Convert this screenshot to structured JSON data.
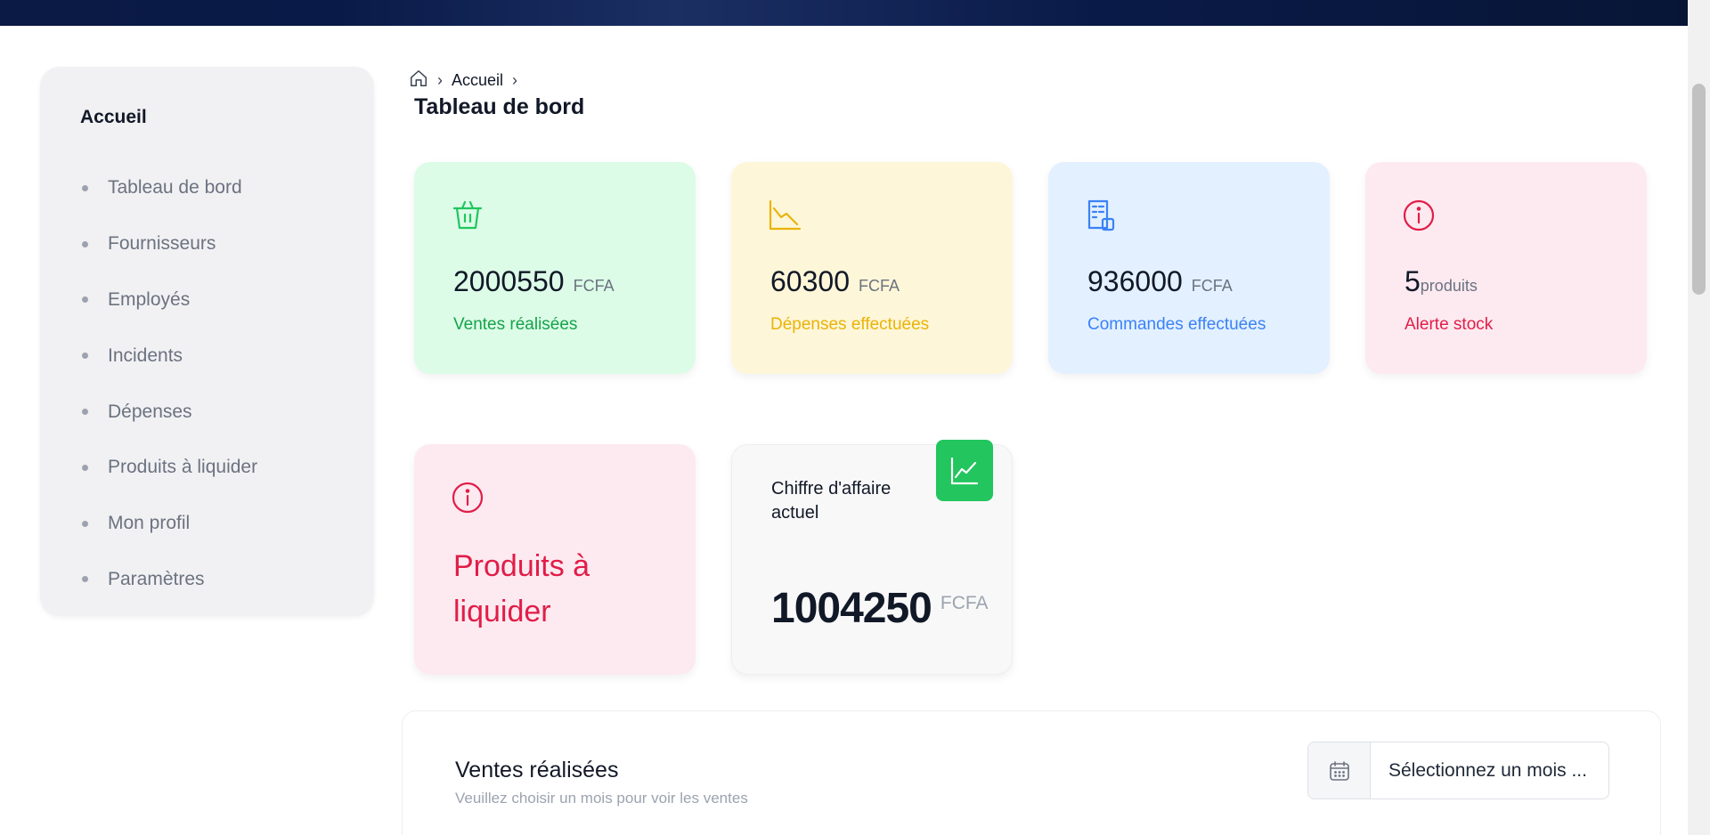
{
  "breadcrumb": {
    "items": [
      "Accueil"
    ]
  },
  "page_title": "Tableau de bord",
  "sidebar": {
    "heading": "Accueil",
    "items": [
      {
        "label": "Tableau de bord"
      },
      {
        "label": "Fournisseurs"
      },
      {
        "label": "Employés"
      },
      {
        "label": "Incidents"
      },
      {
        "label": "Dépenses"
      },
      {
        "label": "Produits à liquider"
      },
      {
        "label": "Mon profil"
      },
      {
        "label": "Paramètres"
      }
    ]
  },
  "stats": [
    {
      "value": "2000550",
      "unit": "FCFA",
      "label": "Ventes réalisées",
      "icon": "basket-icon",
      "color": "#22c55e"
    },
    {
      "value": "60300",
      "unit": "FCFA",
      "label": "Dépenses effectuées",
      "icon": "chart-down-icon",
      "color": "#eab308"
    },
    {
      "value": "936000",
      "unit": "FCFA",
      "label": "Commandes effectuées",
      "icon": "receipt-icon",
      "color": "#3b82f6"
    },
    {
      "value": "5",
      "unit": "produits",
      "label": "Alerte stock",
      "icon": "info-icon",
      "color": "#e11d48"
    }
  ],
  "liquidation_card": {
    "line1": "Produits à",
    "line2": "liquider",
    "color": "#e11d48"
  },
  "revenue_card": {
    "title": "Chiffre d'affaire actuel",
    "value": "1004250",
    "unit": "FCFA",
    "badge_color": "#22c55e"
  },
  "sales_section": {
    "title": "Ventes réalisées",
    "subtitle": "Veuillez choisir un mois pour voir les ventes",
    "month_picker_placeholder": "Sélectionnez un mois ..."
  }
}
